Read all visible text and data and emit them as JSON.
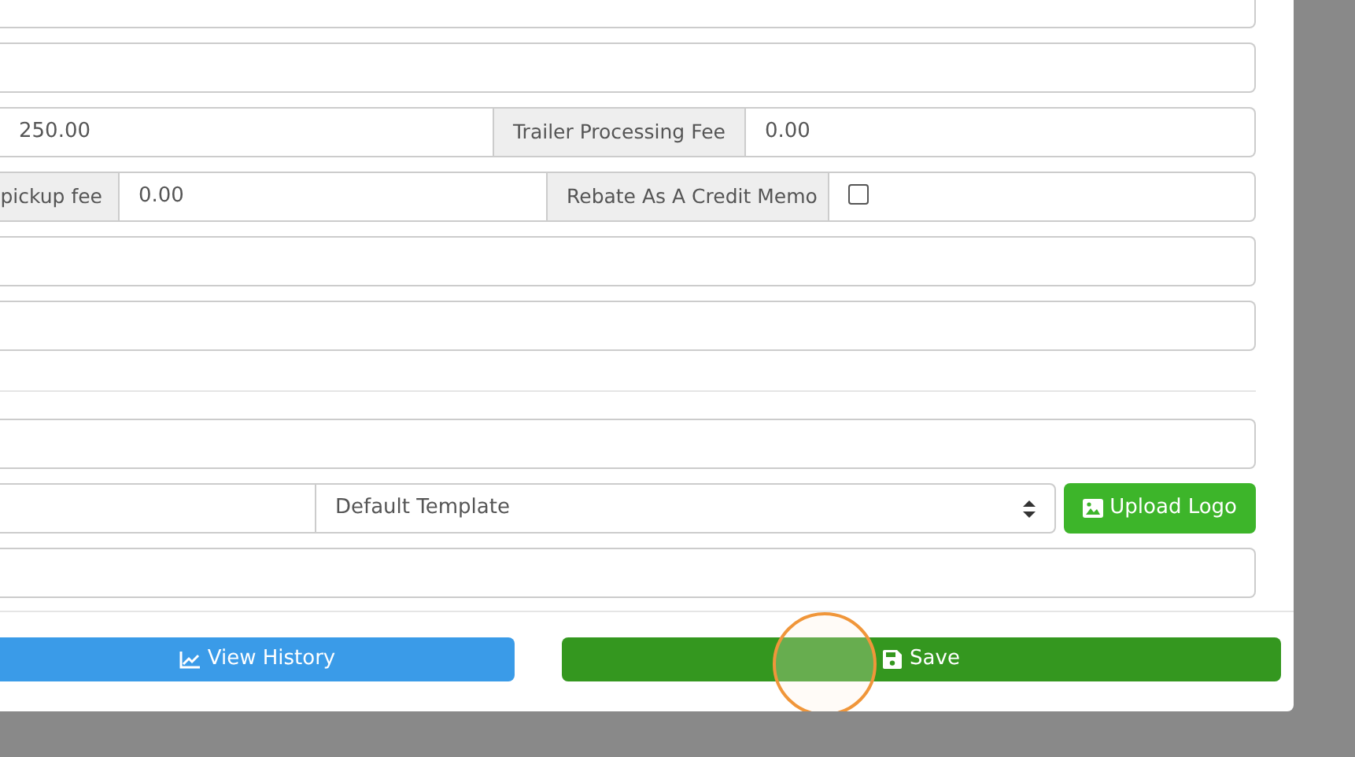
{
  "form": {
    "rows": [
      {
        "kind": "input"
      },
      {
        "kind": "input"
      },
      {
        "kind": "fee",
        "value": "250.00",
        "label": "Trailer Processing Fee",
        "value_2": "0.00"
      },
      {
        "kind": "rebate",
        "label": "pickup fee",
        "value": "0.00",
        "label_2": "Rebate As A Credit Memo",
        "checked": false
      },
      {
        "kind": "input"
      },
      {
        "kind": "input"
      },
      {
        "kind": "divider"
      },
      {
        "kind": "input"
      },
      {
        "kind": "template",
        "template": "Default Template",
        "button": "Upload Logo"
      },
      {
        "kind": "input"
      }
    ]
  },
  "footer": {
    "buttons": [
      {
        "kind": "history",
        "label": "View History"
      },
      {
        "kind": "save",
        "label": "Save"
      }
    ]
  },
  "click_highlight": true
}
